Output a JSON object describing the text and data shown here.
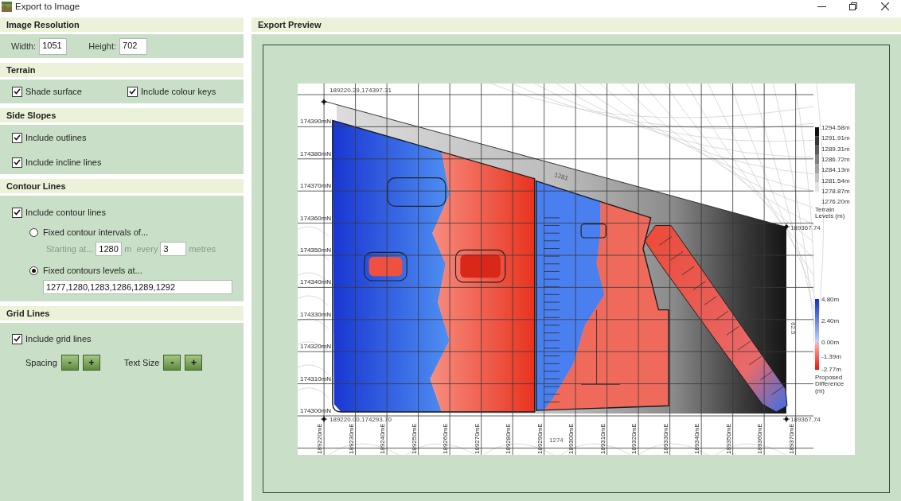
{
  "window": {
    "title": "Export to Image"
  },
  "image_resolution": {
    "title": "Image Resolution",
    "fields": [
      {
        "label": "Width:",
        "value": "1051"
      },
      {
        "label": "Height:",
        "value": "702"
      }
    ]
  },
  "terrain": {
    "title": "Terrain",
    "options": [
      {
        "label": "Shade surface",
        "checked": true
      },
      {
        "label": "Include colour keys",
        "checked": true
      }
    ]
  },
  "side_slopes": {
    "title": "Side Slopes",
    "options": [
      {
        "label": "Include outlines",
        "checked": true
      },
      {
        "label": "Include incline lines",
        "checked": true
      }
    ]
  },
  "contour_lines": {
    "title": "Contour Lines",
    "include": {
      "label": "Include contour lines",
      "checked": true
    },
    "modes": [
      {
        "kind": "interval",
        "label": "Fixed contour intervals of...",
        "selected": false,
        "start_label": "Starting at...",
        "start": "1280",
        "start_unit": "m",
        "every_label": "every",
        "every": "3",
        "every_unit": "metres"
      },
      {
        "kind": "levels",
        "label": "Fixed contours levels at...",
        "selected": true,
        "levels": "1277,1280,1283,1286,1289,1292"
      }
    ]
  },
  "grid_lines": {
    "title": "Grid Lines",
    "include": {
      "label": "Include grid lines",
      "checked": true
    },
    "adjusters": [
      {
        "label": "Spacing",
        "buttons": [
          "-",
          "+"
        ]
      },
      {
        "label": "Text Size",
        "buttons": [
          "-",
          "+"
        ]
      }
    ]
  },
  "preview": {
    "title": "Export Preview",
    "map": {
      "northings": [
        "174390mN",
        "174380mN",
        "174370mN",
        "174360mN",
        "174350mN",
        "174340mN",
        "174330mN",
        "174320mN",
        "174310mN",
        "174300mN"
      ],
      "eastings": [
        "189220mE",
        "189230mE",
        "189240mE",
        "189250mE",
        "189260mE",
        "189270mE",
        "189280mE",
        "189290mE",
        "189300mE",
        "189310mE",
        "189320mE",
        "189330mE",
        "189340mE",
        "189350mE",
        "189360mE",
        "189370mE"
      ],
      "point_labels": [
        "189220.29,174397.31",
        "189367.74",
        "189220.00,174293.70",
        "189367.74"
      ],
      "contour_labels": [
        "1281",
        "62.5",
        "1274"
      ],
      "terrain_key": {
        "title": "Terrain Levels (m)",
        "labels": [
          "1294.58m",
          "1291.91m",
          "1289.31m",
          "1286.72m",
          "1284.13m",
          "1281.54m",
          "1278.87m",
          "1276.20m"
        ]
      },
      "difference_key": {
        "title": "Proposed Difference (m)",
        "labels": [
          "4.80m",
          "2.40m",
          "0.00m",
          "-1.39m",
          "-2.77m"
        ]
      }
    }
  }
}
